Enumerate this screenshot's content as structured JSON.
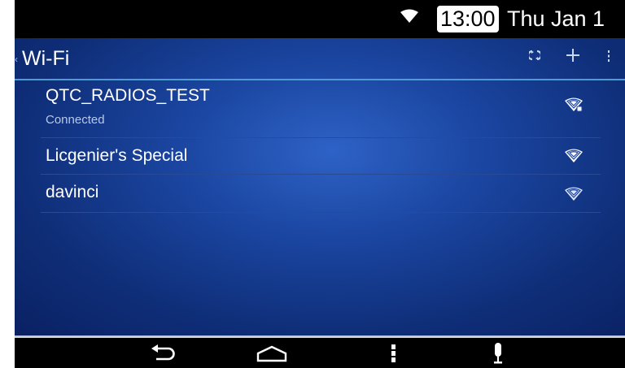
{
  "status_bar": {
    "time": "13:00",
    "date": "Thu Jan 1",
    "wifi_icon": "wifi-signal-icon"
  },
  "action_bar": {
    "title": "Wi-Fi",
    "icons": [
      "wps-icon",
      "add-network-icon",
      "overflow-menu-icon"
    ]
  },
  "networks": [
    {
      "ssid": "QTC_RADIOS_TEST",
      "status": "Connected",
      "signal_icon": "wifi-signal-icon",
      "secured": true
    },
    {
      "ssid": "Licgenier's Special",
      "status": "",
      "signal_icon": "wifi-signal-icon",
      "secured": false
    },
    {
      "ssid": "davinci",
      "status": "",
      "signal_icon": "wifi-signal-icon",
      "secured": false
    }
  ],
  "nav_bar": {
    "icons": [
      "back-icon",
      "home-icon",
      "menu-icon",
      "microphone-icon"
    ]
  },
  "colors": {
    "background_center": "#2e62c6",
    "background_edge": "#0a2163",
    "accent_line": "#4f9bd6"
  }
}
